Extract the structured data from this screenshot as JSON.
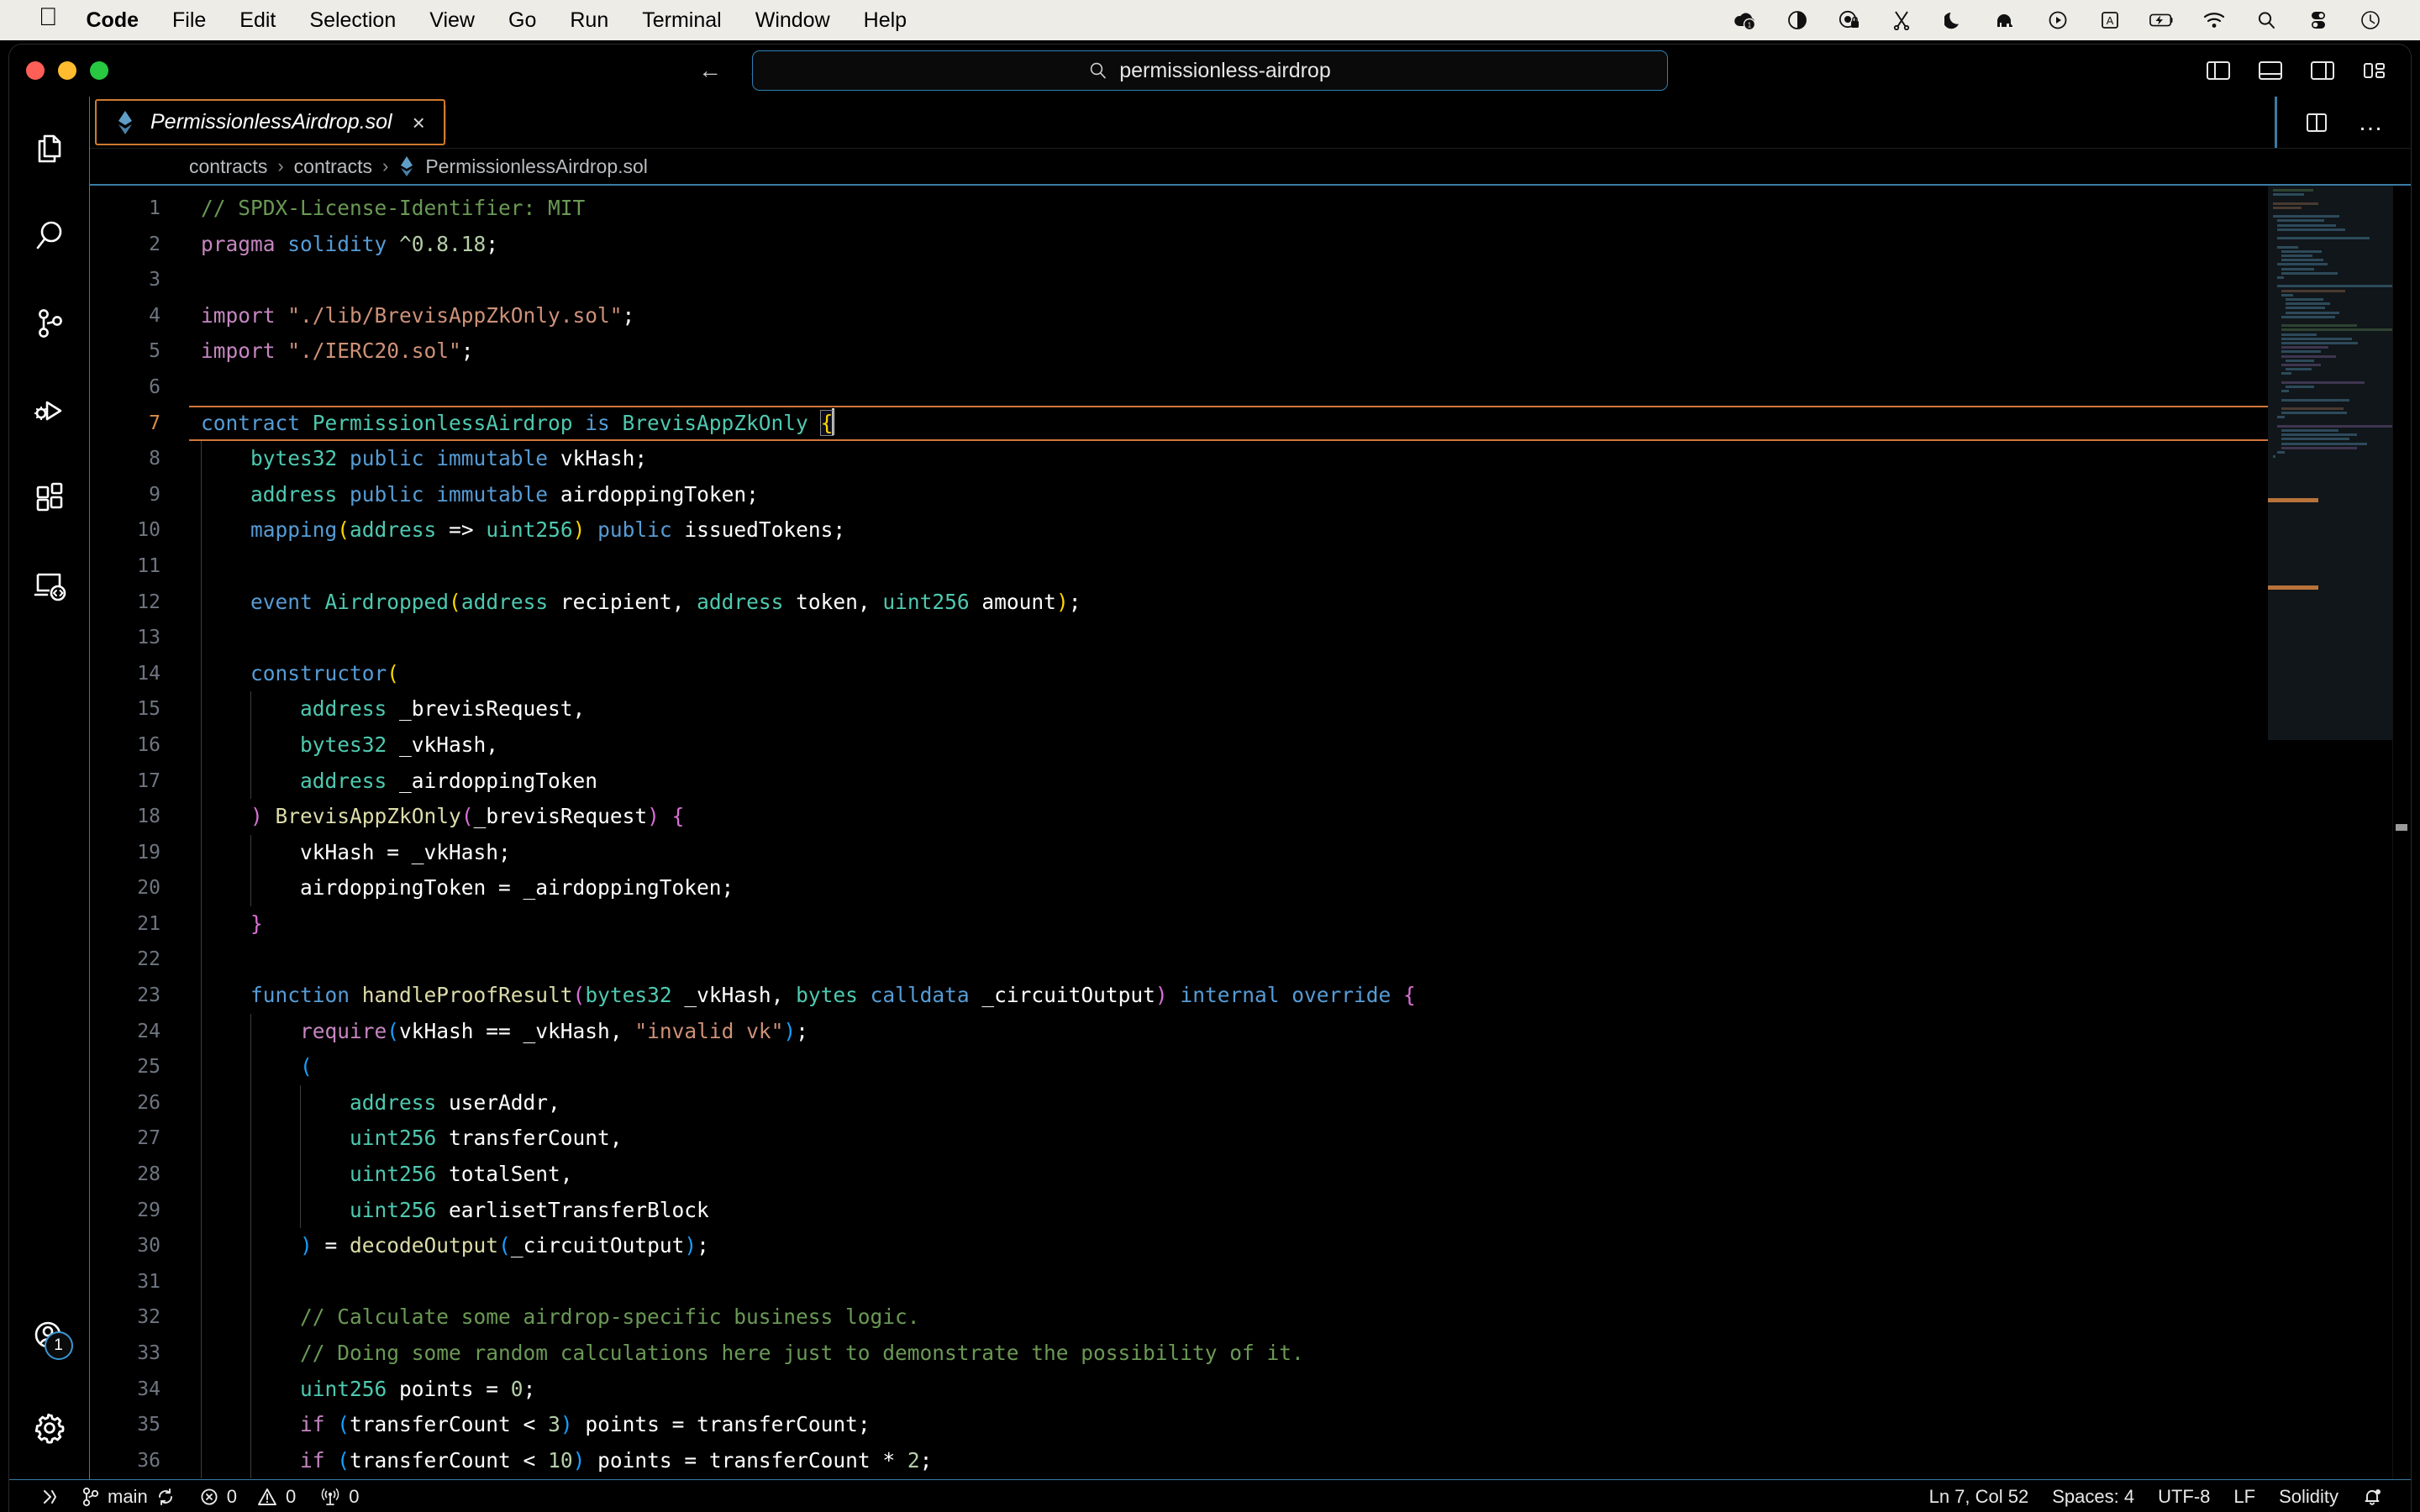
{
  "macos_menubar": {
    "apple_glyph": "",
    "items": [
      {
        "label": "Code",
        "bold": true
      },
      {
        "label": "File",
        "bold": false
      },
      {
        "label": "Edit",
        "bold": false
      },
      {
        "label": "Selection",
        "bold": false
      },
      {
        "label": "View",
        "bold": false
      },
      {
        "label": "Go",
        "bold": false
      },
      {
        "label": "Run",
        "bold": false
      },
      {
        "label": "Terminal",
        "bold": false
      },
      {
        "label": "Window",
        "bold": false
      },
      {
        "label": "Help",
        "bold": false
      }
    ],
    "status_icons": [
      "cloud-sync-badge-icon",
      "contrast-icon",
      "lock-record-icon",
      "scissors-icon",
      "moon-icon",
      "elephant-icon",
      "play-circle-icon",
      "input-source-a-icon",
      "battery-charging-icon",
      "wifi-icon",
      "spotlight-search-icon",
      "control-center-icon",
      "clock-icon"
    ]
  },
  "titlebar": {
    "traffic_lights": [
      "close",
      "minimize",
      "maximize"
    ],
    "nav_back": "←",
    "nav_forward": "→",
    "command_center": {
      "icon": "search-icon",
      "text": "permissionless-airdrop"
    },
    "layout_buttons": [
      "toggle-primary-sidebar-icon",
      "toggle-panel-icon",
      "toggle-secondary-sidebar-icon",
      "customize-layout-icon"
    ]
  },
  "activity_bar": {
    "items": [
      {
        "name": "explorer",
        "icon": "files-icon"
      },
      {
        "name": "search",
        "icon": "search-icon"
      },
      {
        "name": "source-control",
        "icon": "source-control-icon"
      },
      {
        "name": "run-and-debug",
        "icon": "run-debug-icon"
      },
      {
        "name": "extensions",
        "icon": "extensions-icon"
      },
      {
        "name": "remote-explorer",
        "icon": "remote-explorer-icon"
      }
    ],
    "bottom_items": [
      {
        "name": "accounts",
        "icon": "account-icon",
        "badge": "1"
      },
      {
        "name": "manage-settings",
        "icon": "gear-icon",
        "badge": ""
      }
    ]
  },
  "tabs": [
    {
      "label": "PermissionlessAirdrop.sol",
      "icon": "solidity-file-icon",
      "close_glyph": "×",
      "active": true,
      "dirty": false
    }
  ],
  "editor_actions": {
    "split_editor": "split-editor-icon",
    "more_actions": "…"
  },
  "breadcrumbs": {
    "separator": "›",
    "items": [
      {
        "label": "contracts",
        "icon": ""
      },
      {
        "label": "contracts",
        "icon": ""
      },
      {
        "label": "PermissionlessAirdrop.sol",
        "icon": "solidity-file-icon"
      }
    ]
  },
  "editor": {
    "language": "Solidity",
    "current_line": 7,
    "first_visible_line": 1,
    "last_visible_line": 36,
    "cursor": {
      "line": 7,
      "column": 52
    },
    "lines": [
      {
        "n": 1,
        "indent": 0,
        "tokens": [
          {
            "t": "// SPDX-License-Identifier: MIT",
            "c": "c-comment"
          }
        ]
      },
      {
        "n": 2,
        "indent": 0,
        "tokens": [
          {
            "t": "pragma ",
            "c": "c-keyword"
          },
          {
            "t": "solidity ",
            "c": "c-builtin"
          },
          {
            "t": "^0.8.18",
            "c": "c-number"
          },
          {
            "t": ";",
            "c": "c-plain"
          }
        ]
      },
      {
        "n": 3,
        "indent": 0,
        "tokens": []
      },
      {
        "n": 4,
        "indent": 0,
        "tokens": [
          {
            "t": "import ",
            "c": "c-keyword"
          },
          {
            "t": "\"./lib/BrevisAppZkOnly.sol\"",
            "c": "c-string"
          },
          {
            "t": ";",
            "c": "c-plain"
          }
        ]
      },
      {
        "n": 5,
        "indent": 0,
        "tokens": [
          {
            "t": "import ",
            "c": "c-keyword"
          },
          {
            "t": "\"./IERC20.sol\"",
            "c": "c-string"
          },
          {
            "t": ";",
            "c": "c-plain"
          }
        ]
      },
      {
        "n": 6,
        "indent": 0,
        "tokens": []
      },
      {
        "n": 7,
        "indent": 0,
        "current": true,
        "tokens": [
          {
            "t": "contract ",
            "c": "c-builtin"
          },
          {
            "t": "PermissionlessAirdrop ",
            "c": "c-class"
          },
          {
            "t": "is ",
            "c": "c-builtin"
          },
          {
            "t": "BrevisAppZkOnly ",
            "c": "c-class"
          },
          {
            "t": "{",
            "c": "c-paren1 brace-match"
          }
        ],
        "cursor_after": true
      },
      {
        "n": 8,
        "indent": 1,
        "tokens": [
          {
            "t": "    ",
            "c": "c-plain"
          },
          {
            "t": "bytes32 ",
            "c": "c-type"
          },
          {
            "t": "public ",
            "c": "c-builtin"
          },
          {
            "t": "immutable ",
            "c": "c-builtin"
          },
          {
            "t": "vkHash;",
            "c": "c-plain"
          }
        ]
      },
      {
        "n": 9,
        "indent": 1,
        "tokens": [
          {
            "t": "    ",
            "c": "c-plain"
          },
          {
            "t": "address ",
            "c": "c-type"
          },
          {
            "t": "public ",
            "c": "c-builtin"
          },
          {
            "t": "immutable ",
            "c": "c-builtin"
          },
          {
            "t": "airdoppingToken;",
            "c": "c-plain"
          }
        ]
      },
      {
        "n": 10,
        "indent": 1,
        "tokens": [
          {
            "t": "    ",
            "c": "c-plain"
          },
          {
            "t": "mapping",
            "c": "c-builtin"
          },
          {
            "t": "(",
            "c": "c-paren1"
          },
          {
            "t": "address ",
            "c": "c-type"
          },
          {
            "t": "=> ",
            "c": "c-plain"
          },
          {
            "t": "uint256",
            "c": "c-type"
          },
          {
            "t": ")",
            "c": "c-paren1"
          },
          {
            "t": " ",
            "c": "c-plain"
          },
          {
            "t": "public ",
            "c": "c-builtin"
          },
          {
            "t": "issuedTokens;",
            "c": "c-plain"
          }
        ]
      },
      {
        "n": 11,
        "indent": 1,
        "tokens": []
      },
      {
        "n": 12,
        "indent": 1,
        "tokens": [
          {
            "t": "    ",
            "c": "c-plain"
          },
          {
            "t": "event ",
            "c": "c-builtin"
          },
          {
            "t": "Airdropped",
            "c": "c-class"
          },
          {
            "t": "(",
            "c": "c-paren1"
          },
          {
            "t": "address ",
            "c": "c-type"
          },
          {
            "t": "recipient",
            "c": "c-plain"
          },
          {
            "t": ", ",
            "c": "c-plain"
          },
          {
            "t": "address ",
            "c": "c-type"
          },
          {
            "t": "token",
            "c": "c-plain"
          },
          {
            "t": ", ",
            "c": "c-plain"
          },
          {
            "t": "uint256 ",
            "c": "c-type"
          },
          {
            "t": "amount",
            "c": "c-plain"
          },
          {
            "t": ")",
            "c": "c-paren1"
          },
          {
            "t": ";",
            "c": "c-plain"
          }
        ]
      },
      {
        "n": 13,
        "indent": 1,
        "tokens": []
      },
      {
        "n": 14,
        "indent": 1,
        "tokens": [
          {
            "t": "    ",
            "c": "c-plain"
          },
          {
            "t": "constructor",
            "c": "c-builtin"
          },
          {
            "t": "(",
            "c": "c-paren1"
          }
        ]
      },
      {
        "n": 15,
        "indent": 2,
        "tokens": [
          {
            "t": "        ",
            "c": "c-plain"
          },
          {
            "t": "address ",
            "c": "c-type"
          },
          {
            "t": "_brevisRequest",
            "c": "c-plain"
          },
          {
            "t": ",",
            "c": "c-plain"
          }
        ]
      },
      {
        "n": 16,
        "indent": 2,
        "tokens": [
          {
            "t": "        ",
            "c": "c-plain"
          },
          {
            "t": "bytes32 ",
            "c": "c-type"
          },
          {
            "t": "_vkHash",
            "c": "c-plain"
          },
          {
            "t": ",",
            "c": "c-plain"
          }
        ]
      },
      {
        "n": 17,
        "indent": 2,
        "tokens": [
          {
            "t": "        ",
            "c": "c-plain"
          },
          {
            "t": "address ",
            "c": "c-type"
          },
          {
            "t": "_airdoppingToken",
            "c": "c-plain"
          }
        ]
      },
      {
        "n": 18,
        "indent": 1,
        "tokens": [
          {
            "t": "    ",
            "c": "c-plain"
          },
          {
            "t": ")",
            "c": "c-paren2"
          },
          {
            "t": " ",
            "c": "c-plain"
          },
          {
            "t": "BrevisAppZkOnly",
            "c": "c-func"
          },
          {
            "t": "(",
            "c": "c-paren2"
          },
          {
            "t": "_brevisRequest",
            "c": "c-plain"
          },
          {
            "t": ")",
            "c": "c-paren2"
          },
          {
            "t": " ",
            "c": "c-plain"
          },
          {
            "t": "{",
            "c": "c-paren2"
          }
        ]
      },
      {
        "n": 19,
        "indent": 2,
        "tokens": [
          {
            "t": "        vkHash = _vkHash;",
            "c": "c-plain"
          }
        ]
      },
      {
        "n": 20,
        "indent": 2,
        "tokens": [
          {
            "t": "        airdoppingToken = _airdoppingToken;",
            "c": "c-plain"
          }
        ]
      },
      {
        "n": 21,
        "indent": 1,
        "tokens": [
          {
            "t": "    ",
            "c": "c-plain"
          },
          {
            "t": "}",
            "c": "c-paren2"
          }
        ]
      },
      {
        "n": 22,
        "indent": 1,
        "tokens": []
      },
      {
        "n": 23,
        "indent": 1,
        "tokens": [
          {
            "t": "    ",
            "c": "c-plain"
          },
          {
            "t": "function ",
            "c": "c-builtin"
          },
          {
            "t": "handleProofResult",
            "c": "c-func"
          },
          {
            "t": "(",
            "c": "c-paren2"
          },
          {
            "t": "bytes32 ",
            "c": "c-type"
          },
          {
            "t": "_vkHash",
            "c": "c-plain"
          },
          {
            "t": ", ",
            "c": "c-plain"
          },
          {
            "t": "bytes ",
            "c": "c-type"
          },
          {
            "t": "calldata ",
            "c": "c-builtin"
          },
          {
            "t": "_circuitOutput",
            "c": "c-plain"
          },
          {
            "t": ")",
            "c": "c-paren2"
          },
          {
            "t": " ",
            "c": "c-plain"
          },
          {
            "t": "internal ",
            "c": "c-builtin"
          },
          {
            "t": "override ",
            "c": "c-builtin"
          },
          {
            "t": "{",
            "c": "c-paren2"
          }
        ]
      },
      {
        "n": 24,
        "indent": 2,
        "tokens": [
          {
            "t": "        ",
            "c": "c-plain"
          },
          {
            "t": "require",
            "c": "c-keyword"
          },
          {
            "t": "(",
            "c": "c-paren3"
          },
          {
            "t": "vkHash == _vkHash",
            "c": "c-plain"
          },
          {
            "t": ", ",
            "c": "c-plain"
          },
          {
            "t": "\"invalid vk\"",
            "c": "c-string"
          },
          {
            "t": ")",
            "c": "c-paren3"
          },
          {
            "t": ";",
            "c": "c-plain"
          }
        ]
      },
      {
        "n": 25,
        "indent": 2,
        "tokens": [
          {
            "t": "        ",
            "c": "c-plain"
          },
          {
            "t": "(",
            "c": "c-paren3"
          }
        ]
      },
      {
        "n": 26,
        "indent": 3,
        "tokens": [
          {
            "t": "            ",
            "c": "c-plain"
          },
          {
            "t": "address ",
            "c": "c-type"
          },
          {
            "t": "userAddr",
            "c": "c-plain"
          },
          {
            "t": ",",
            "c": "c-plain"
          }
        ]
      },
      {
        "n": 27,
        "indent": 3,
        "tokens": [
          {
            "t": "            ",
            "c": "c-plain"
          },
          {
            "t": "uint256 ",
            "c": "c-type"
          },
          {
            "t": "transferCount",
            "c": "c-plain"
          },
          {
            "t": ",",
            "c": "c-plain"
          }
        ]
      },
      {
        "n": 28,
        "indent": 3,
        "tokens": [
          {
            "t": "            ",
            "c": "c-plain"
          },
          {
            "t": "uint256 ",
            "c": "c-type"
          },
          {
            "t": "totalSent",
            "c": "c-plain"
          },
          {
            "t": ",",
            "c": "c-plain"
          }
        ]
      },
      {
        "n": 29,
        "indent": 3,
        "tokens": [
          {
            "t": "            ",
            "c": "c-plain"
          },
          {
            "t": "uint256 ",
            "c": "c-type"
          },
          {
            "t": "earlisetTransferBlock",
            "c": "c-plain"
          }
        ]
      },
      {
        "n": 30,
        "indent": 2,
        "tokens": [
          {
            "t": "        ",
            "c": "c-plain"
          },
          {
            "t": ")",
            "c": "c-paren3"
          },
          {
            "t": " = ",
            "c": "c-plain"
          },
          {
            "t": "decodeOutput",
            "c": "c-func"
          },
          {
            "t": "(",
            "c": "c-paren3"
          },
          {
            "t": "_circuitOutput",
            "c": "c-plain"
          },
          {
            "t": ")",
            "c": "c-paren3"
          },
          {
            "t": ";",
            "c": "c-plain"
          }
        ]
      },
      {
        "n": 31,
        "indent": 2,
        "tokens": []
      },
      {
        "n": 32,
        "indent": 2,
        "tokens": [
          {
            "t": "        ",
            "c": "c-plain"
          },
          {
            "t": "// Calculate some airdrop-specific business logic.",
            "c": "c-comment"
          }
        ]
      },
      {
        "n": 33,
        "indent": 2,
        "tokens": [
          {
            "t": "        ",
            "c": "c-plain"
          },
          {
            "t": "// Doing some random calculations here just to demonstrate the possibility of it.",
            "c": "c-comment"
          }
        ]
      },
      {
        "n": 34,
        "indent": 2,
        "tokens": [
          {
            "t": "        ",
            "c": "c-plain"
          },
          {
            "t": "uint256 ",
            "c": "c-type"
          },
          {
            "t": "points = ",
            "c": "c-plain"
          },
          {
            "t": "0",
            "c": "c-number"
          },
          {
            "t": ";",
            "c": "c-plain"
          }
        ]
      },
      {
        "n": 35,
        "indent": 2,
        "tokens": [
          {
            "t": "        ",
            "c": "c-plain"
          },
          {
            "t": "if ",
            "c": "c-control"
          },
          {
            "t": "(",
            "c": "c-paren3"
          },
          {
            "t": "transferCount < ",
            "c": "c-plain"
          },
          {
            "t": "3",
            "c": "c-number"
          },
          {
            "t": ")",
            "c": "c-paren3"
          },
          {
            "t": " points = transferCount;",
            "c": "c-plain"
          }
        ]
      },
      {
        "n": 36,
        "indent": 2,
        "tokens": [
          {
            "t": "        ",
            "c": "c-plain"
          },
          {
            "t": "if ",
            "c": "c-control"
          },
          {
            "t": "(",
            "c": "c-paren3"
          },
          {
            "t": "transferCount < ",
            "c": "c-plain"
          },
          {
            "t": "10",
            "c": "c-number"
          },
          {
            "t": ")",
            "c": "c-paren3"
          },
          {
            "t": " points = transferCount * ",
            "c": "c-plain"
          },
          {
            "t": "2",
            "c": "c-number"
          },
          {
            "t": ";",
            "c": "c-plain"
          }
        ]
      }
    ]
  },
  "minimap": {
    "slider_visible": true,
    "markers": 2
  },
  "statusbar": {
    "left": [
      {
        "name": "remote-host",
        "icon": "remote-icon",
        "label": ""
      },
      {
        "name": "branch",
        "icon": "git-branch-icon",
        "label": "main",
        "trailing_icon": "sync-icon"
      },
      {
        "name": "problems-errors",
        "icon": "error-icon",
        "label": "0"
      },
      {
        "name": "problems-warnings",
        "icon": "warning-icon",
        "label": "0"
      },
      {
        "name": "ports",
        "icon": "radio-tower-icon",
        "label": "0"
      }
    ],
    "right": [
      {
        "name": "editor-position",
        "label": "Ln 7, Col 52"
      },
      {
        "name": "editor-indentation",
        "label": "Spaces: 4"
      },
      {
        "name": "editor-encoding",
        "label": "UTF-8"
      },
      {
        "name": "editor-eol",
        "label": "LF"
      },
      {
        "name": "editor-language",
        "label": "Solidity"
      },
      {
        "name": "notifications",
        "label": "",
        "icon": "bell-dot-icon"
      }
    ]
  },
  "colors": {
    "background": "#000000",
    "accent_border": "#3a7ca5",
    "tab_focus_border": "#cf7a2e",
    "current_line_border": "#d4763a",
    "command_center_border": "#2f7fb5",
    "menubar_bg": "#edece7",
    "comment": "#6a9955",
    "keyword": "#c586c0",
    "type": "#4ec9b0",
    "builtin": "#569cd6",
    "string": "#ce9178",
    "number": "#b5cea8",
    "function": "#dcdcaa"
  }
}
